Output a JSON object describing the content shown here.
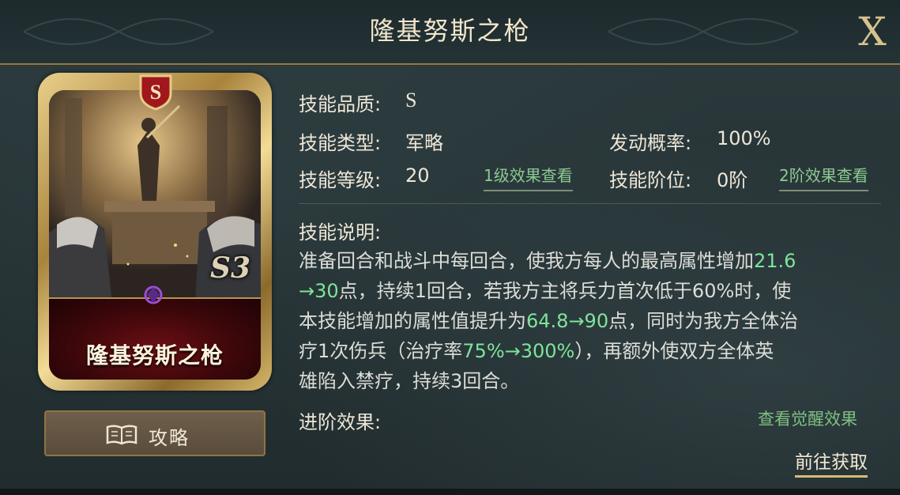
{
  "header": {
    "title": "隆基努斯之枪",
    "close_label": "X"
  },
  "card": {
    "grade": "S",
    "name": "隆基努斯之枪",
    "code": "S3"
  },
  "strategy_button": {
    "label": "攻略"
  },
  "info": {
    "quality": {
      "label": "技能品质:",
      "value": "S"
    },
    "type": {
      "label": "技能类型:",
      "value": "军略"
    },
    "level": {
      "label": "技能等级:",
      "value": "20",
      "link": "1级效果查看"
    },
    "chance": {
      "label": "发动概率:",
      "value": "100%"
    },
    "tier": {
      "label": "技能阶位:",
      "value": "0阶",
      "link": "2阶效果查看"
    }
  },
  "description": {
    "label": "技能说明:",
    "line1_a": "准备回合和战斗中每回合，使我方每人的最高属性增加",
    "line1_hl": "21.6",
    "line2_hl": "→30",
    "line2_a": "点，持续1回合，若我方主将兵力首次低于60%时，使",
    "line3_a": "本技能增加的属性值提升为",
    "line3_hl": "64.8→90",
    "line3_b": "点，同时为我方全体治",
    "line4_a": "疗1次伤兵（治疗率",
    "line4_hl": "75%→300%",
    "line4_b": "），再额外使双方全体英",
    "line5_a": "雄陷入禁疗，持续3回合。"
  },
  "advance": {
    "label": "进阶效果:",
    "awaken_link": "查看觉醒效果"
  },
  "obtain_link": "前往获取",
  "colors": {
    "highlight": "#7ee49a",
    "link": "#8cc991",
    "gold": "#d7bc72",
    "card_red": "#6b0f14"
  },
  "icons": {
    "close": "close-icon",
    "book": "book-icon",
    "grade": "grade-badge-icon",
    "gem": "gem-icon"
  }
}
